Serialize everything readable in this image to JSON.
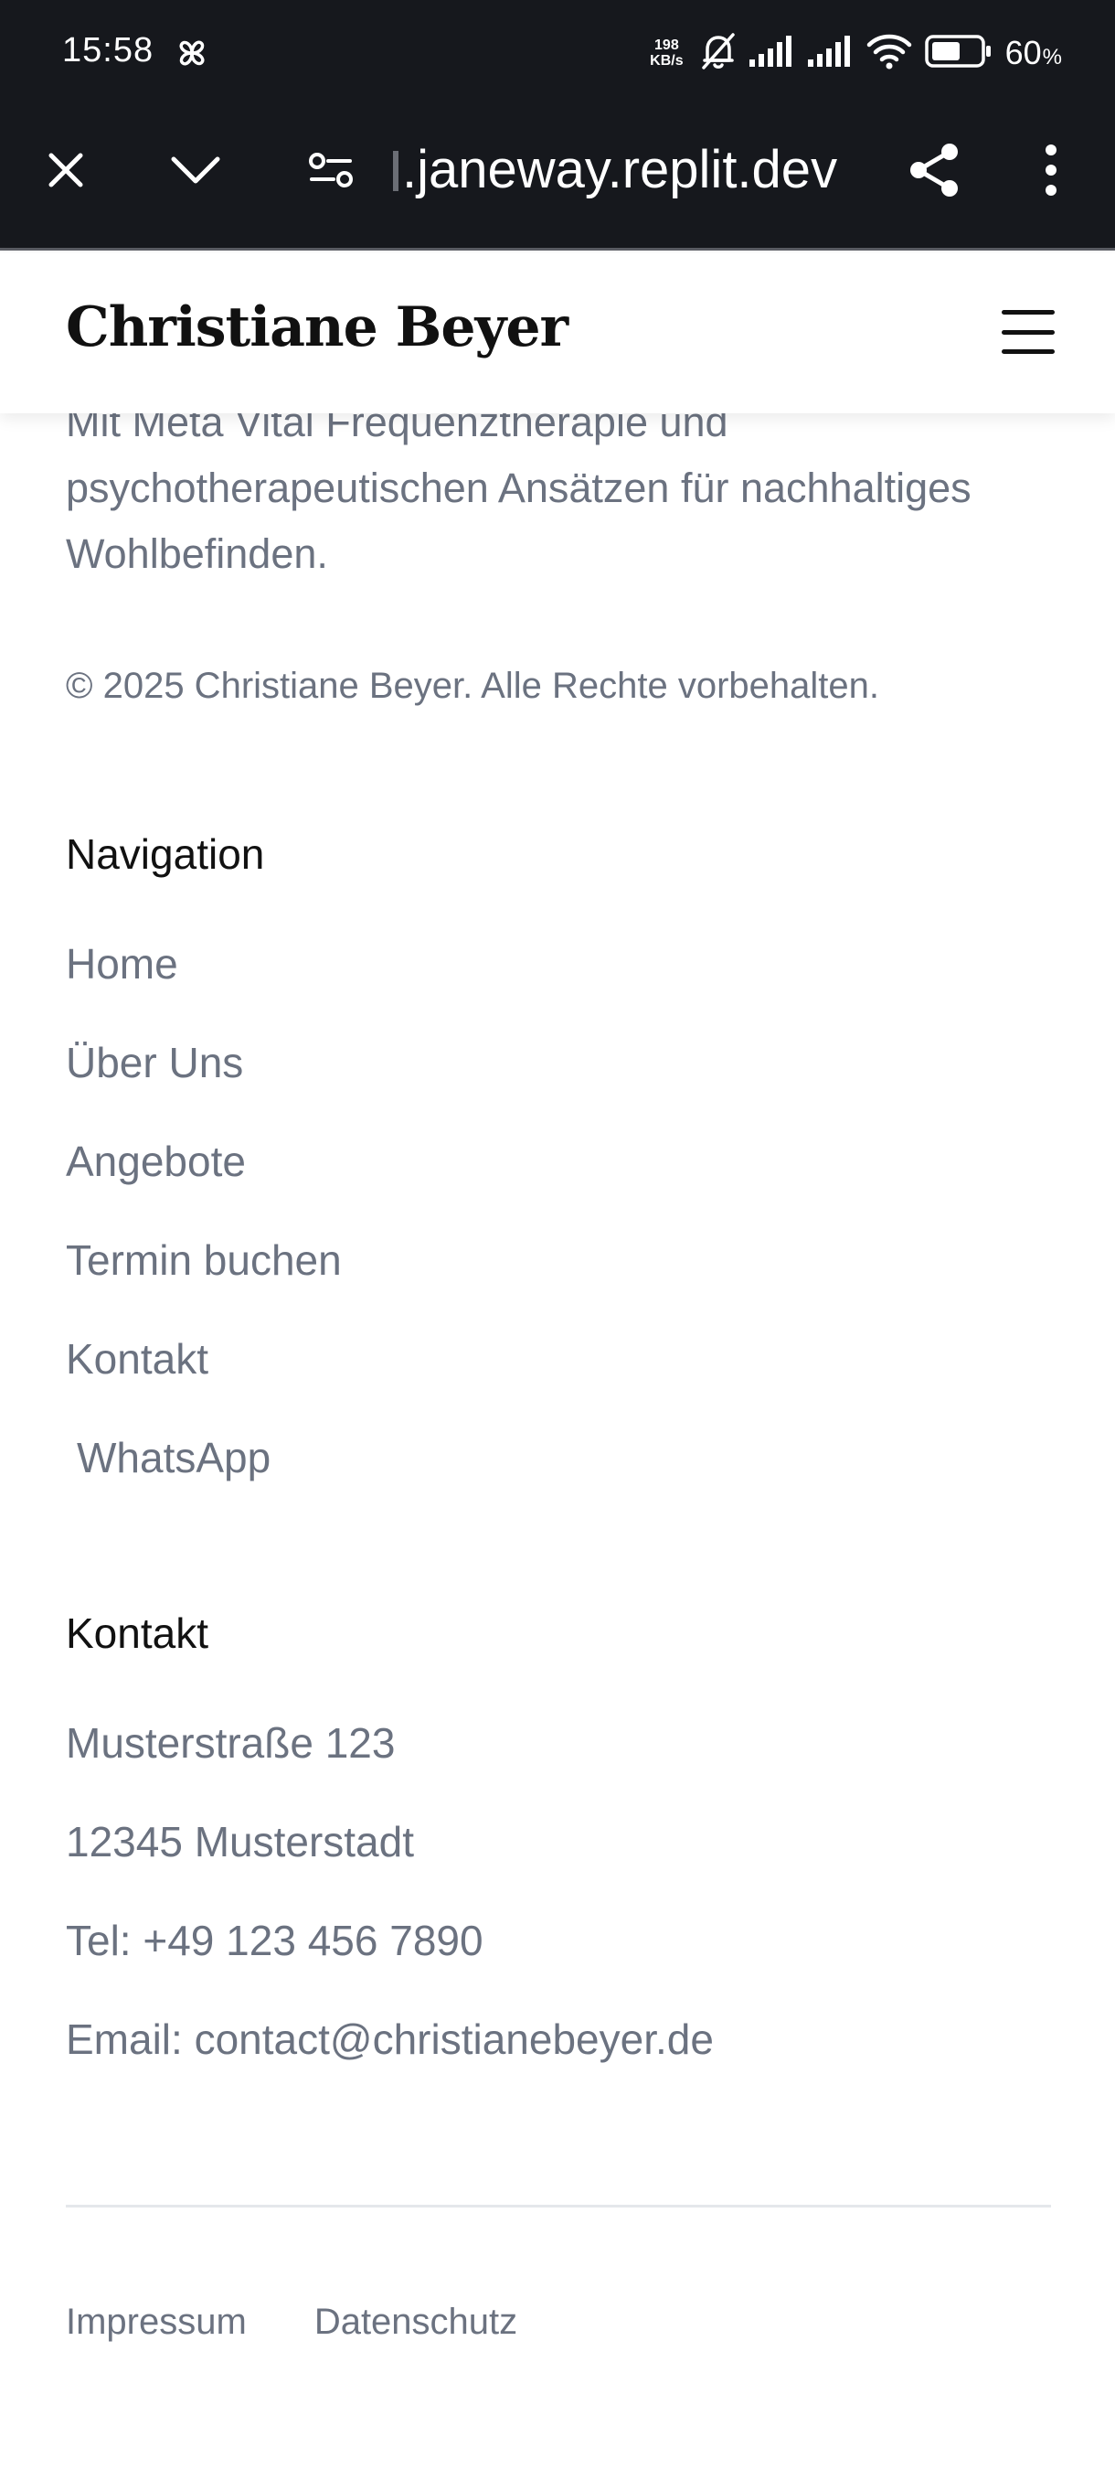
{
  "status_bar": {
    "time": "15:58",
    "net_speed_value": "198",
    "net_speed_unit": "KB/s",
    "battery_percent": "60",
    "battery_unit": "%",
    "battery_level": 0.6
  },
  "browser": {
    "url": ".janeway.replit.dev",
    "icons": [
      "close-icon",
      "chevron-down-icon",
      "site-settings-icon",
      "share-icon",
      "more-vert-icon"
    ]
  },
  "header": {
    "site_title": "Christiane Beyer",
    "menu_icon": "hamburger-menu-icon"
  },
  "footer": {
    "intro_text": "Mit Meta Vital Frequenztherapie und psychotherapeutischen Ansätzen für nachhaltiges Wohlbefinden.",
    "copyright": "© 2025 Christiane Beyer. Alle Rechte vorbehalten.",
    "navigation": {
      "title": "Navigation",
      "items": [
        {
          "label": "Home"
        },
        {
          "label": "Über Uns"
        },
        {
          "label": "Angebote"
        },
        {
          "label": "Termin buchen"
        },
        {
          "label": "Kontakt"
        },
        {
          "label": "WhatsApp"
        }
      ]
    },
    "contact": {
      "title": "Kontakt",
      "street": "Musterstraße 123",
      "city": "12345 Musterstadt",
      "phone": "Tel: +49 123 456 7890",
      "email": "Email: contact@christianebeyer.de"
    },
    "legal_links": {
      "impressum": "Impressum",
      "datenschutz": "Datenschutz"
    }
  },
  "colors": {
    "chrome_bg": "#16181d",
    "text_muted": "#6b7280",
    "text_dark": "#111111",
    "divider": "#e5e7eb"
  }
}
